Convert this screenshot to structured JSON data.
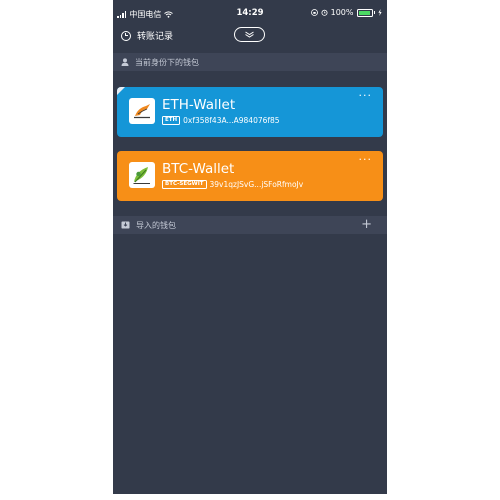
{
  "status_bar": {
    "carrier": "中国电信",
    "time": "14:29",
    "battery_percent": "100%"
  },
  "nav": {
    "history_label": "转账记录"
  },
  "current_section": {
    "label": "当前身份下的钱包"
  },
  "wallets": [
    {
      "name": "ETH-Wallet",
      "chain_tag": "ETH",
      "address": "0xf358f43A...A984076f85",
      "color": "#1596d7",
      "logo_icon": "eth-logo-icon",
      "more_label": "···"
    },
    {
      "name": "BTC-Wallet",
      "chain_tag": "BTC-SEGWIT",
      "address": "39v1qzJSvG...jSFoRfmoJv",
      "color": "#f78f17",
      "logo_icon": "btc-logo-icon",
      "more_label": "···"
    }
  ],
  "imported_section": {
    "label": "导入的钱包",
    "add_label": "+"
  },
  "colors": {
    "background": "#333a4a",
    "section_header": "#3e4557"
  }
}
